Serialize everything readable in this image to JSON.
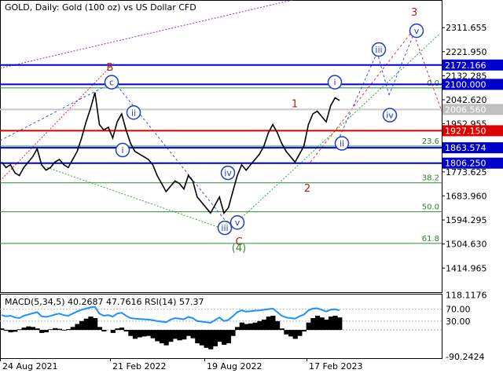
{
  "chart_data": {
    "type": "line",
    "title": "GOLD, Daily:  Gold (100 oz) vs US Dollar CFD",
    "price_ticks": [
      "2311.655",
      "2221.950",
      "2132.285",
      "2042.620",
      "1952.955",
      "1863.574",
      "1773.625",
      "1683.960",
      "1594.295",
      "1504.630",
      "1414.965"
    ],
    "ylim": [
      1325,
      2400
    ],
    "x_ticks": [
      "24 Aug 2021",
      "21 Feb 2022",
      "19 Aug 2022",
      "17 Feb 2023"
    ],
    "levels": [
      {
        "label": "2172.166",
        "value": 2172.166,
        "color": "#0000cc",
        "box": "#0000cc"
      },
      {
        "label": "2100.000",
        "value": 2100.0,
        "color": "#0000cc",
        "box": "#0000cc"
      },
      {
        "label": "2006.560",
        "value": 2006.56,
        "color": "#c8c8c8",
        "box": "#c0c0c0"
      },
      {
        "label": "1927.150",
        "value": 1927.15,
        "color": "#dd0000",
        "box": "#dd0000"
      },
      {
        "label": "1863.574",
        "value": 1863.574,
        "color": "#0000cc",
        "box": "#0000cc"
      },
      {
        "label": "1806.250",
        "value": 1806.25,
        "color": "#0000cc",
        "box": "#0000cc"
      }
    ],
    "fib_levels": [
      {
        "label": "0.0",
        "value": 2087
      },
      {
        "label": "23.6",
        "value": 1870
      },
      {
        "label": "38.2",
        "value": 1733
      },
      {
        "label": "50.0",
        "value": 1625
      },
      {
        "label": "61.8",
        "value": 1507
      }
    ],
    "waves_red": [
      "B",
      "C",
      "1",
      "2",
      "3",
      "(4)"
    ],
    "waves_blue": [
      "c",
      "ii",
      "i",
      "iv",
      "iii",
      "v",
      "i",
      "ii",
      "iii",
      "iv",
      "v"
    ],
    "series": [
      {
        "name": "GOLD",
        "values": [
          1810,
          1790,
          1800,
          1770,
          1760,
          1790,
          1810,
          1830,
          1860,
          1800,
          1780,
          1790,
          1810,
          1820,
          1800,
          1790,
          1820,
          1850,
          1900,
          1960,
          2010,
          2070,
          1950,
          1930,
          1940,
          1900,
          1960,
          1990,
          1930,
          1880,
          1850,
          1840,
          1830,
          1820,
          1800,
          1760,
          1730,
          1700,
          1720,
          1740,
          1730,
          1710,
          1760,
          1740,
          1680,
          1660,
          1640,
          1620,
          1650,
          1680,
          1620,
          1640,
          1700,
          1760,
          1800,
          1780,
          1800,
          1820,
          1840,
          1870,
          1920,
          1950,
          1920,
          1880,
          1850,
          1830,
          1810,
          1840,
          1870,
          1950,
          1990,
          2000,
          1980,
          1960,
          2020,
          2050,
          2040
        ]
      }
    ],
    "indicator": {
      "title": "MACD(5,34,5) 40.2687 47.7616 RSI(14) 57.37",
      "ticks": [
        "118.1176",
        "70.00",
        "30.00",
        "-90.2424"
      ],
      "ylim": [
        -95,
        122
      ],
      "macd": [
        5,
        -3,
        -8,
        -6,
        2,
        8,
        12,
        10,
        5,
        -10,
        -8,
        2,
        6,
        4,
        -2,
        3,
        10,
        20,
        30,
        38,
        45,
        40,
        10,
        -5,
        0,
        -10,
        5,
        8,
        -5,
        -20,
        -30,
        -25,
        -22,
        -20,
        -28,
        -38,
        -45,
        -52,
        -40,
        -30,
        -35,
        -32,
        -20,
        -28,
        -45,
        -52,
        -60,
        -65,
        -55,
        -40,
        -50,
        -45,
        -20,
        10,
        25,
        20,
        22,
        25,
        30,
        35,
        45,
        48,
        30,
        5,
        -15,
        -22,
        -30,
        -20,
        -5,
        25,
        40,
        48,
        42,
        35,
        45,
        48,
        42
      ],
      "rsi": [
        50,
        46,
        48,
        42,
        40,
        48,
        52,
        56,
        60,
        46,
        44,
        47,
        52,
        55,
        50,
        48,
        55,
        62,
        68,
        72,
        76,
        78,
        55,
        48,
        50,
        45,
        55,
        58,
        48,
        40,
        38,
        37,
        36,
        35,
        33,
        30,
        28,
        26,
        35,
        40,
        38,
        36,
        44,
        40,
        30,
        28,
        26,
        24,
        33,
        42,
        30,
        34,
        46,
        60,
        66,
        62,
        63,
        65,
        66,
        68,
        70,
        72,
        60,
        48,
        42,
        40,
        38,
        46,
        52,
        66,
        72,
        73,
        68,
        62,
        68,
        70,
        66
      ]
    }
  }
}
